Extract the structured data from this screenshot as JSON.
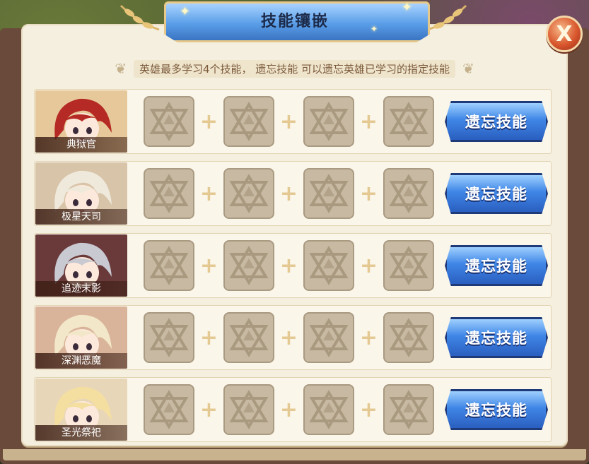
{
  "title": "技能镶嵌",
  "close_label": "X",
  "hint": "英雄最多学习4个技能， 遗忘技能 可以遗忘英雄已学习的指定技能",
  "slot_icon": "empty-skill-star-icon",
  "plus_symbol": "+",
  "colors": {
    "panel": "#f5efe0",
    "button_blue": "#3f86e6",
    "slot": "#c7b9a2",
    "close_red": "#d9582e"
  },
  "heroes": [
    {
      "name": "典狱官",
      "button": "遗忘技能",
      "hair": "#b52a24",
      "bg": "#e6c89a"
    },
    {
      "name": "极星天司",
      "button": "遗忘技能",
      "hair": "#efe9dc",
      "bg": "#d8c4a8"
    },
    {
      "name": "追迹末影",
      "button": "遗忘技能",
      "hair": "#c9c9d2",
      "bg": "#6a3a3a"
    },
    {
      "name": "深渊恶魔",
      "button": "遗忘技能",
      "hair": "#f3e7c9",
      "bg": "#d9b49a"
    },
    {
      "name": "圣光祭祀",
      "button": "遗忘技能",
      "hair": "#f4dfa0",
      "bg": "#e8d6b8"
    }
  ]
}
